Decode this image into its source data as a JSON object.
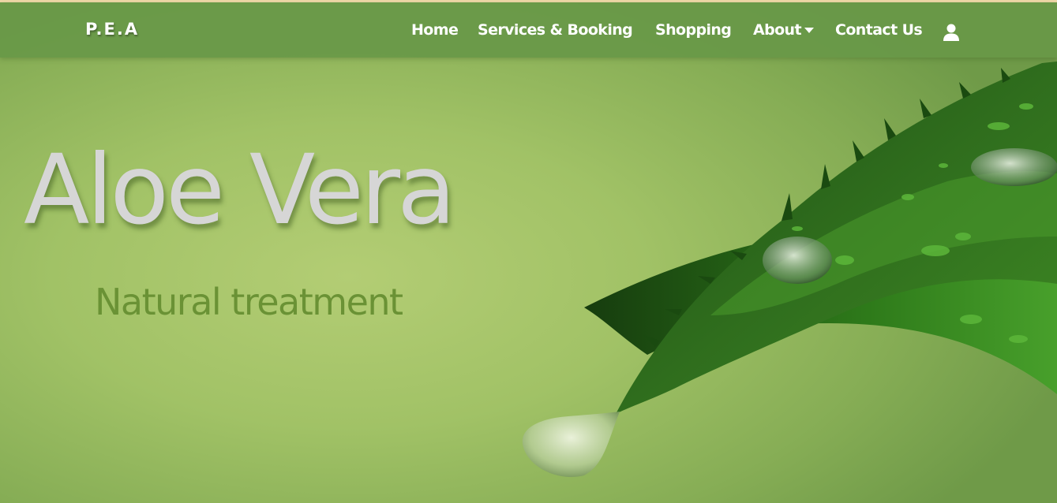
{
  "brand": "P.E.A",
  "nav": {
    "home": "Home",
    "services": "Services & Booking",
    "shopping": "Shopping",
    "about": "About",
    "contact": "Contact Us",
    "about_icon": "caret-down-icon",
    "account_icon": "user-icon"
  },
  "hero": {
    "title": "Aloe Vera",
    "subtitle": "Natural treatment",
    "image": "aloe-vera-leaf-illustration"
  },
  "colors": {
    "navbar": "#689848",
    "background": "#a1c266",
    "title": "#d6d6d6",
    "subtitle": "#6a9235",
    "leaf": "#2f6a1a",
    "top_border": "#f0d9a8"
  }
}
